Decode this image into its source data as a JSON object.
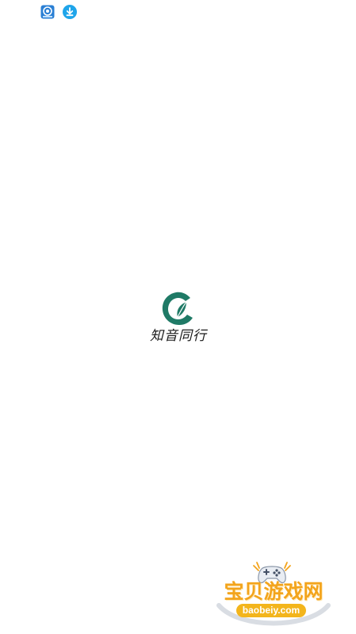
{
  "status_bar": {
    "icons": [
      "app-notification-icon",
      "download-icon"
    ]
  },
  "splash": {
    "brand_name": "知音同行",
    "logo_color": "#1f7a66"
  },
  "watermark": {
    "site_name_cn": "宝贝游戏网",
    "site_url": "baobeiy.com",
    "accent_color": "#f3a41c"
  }
}
